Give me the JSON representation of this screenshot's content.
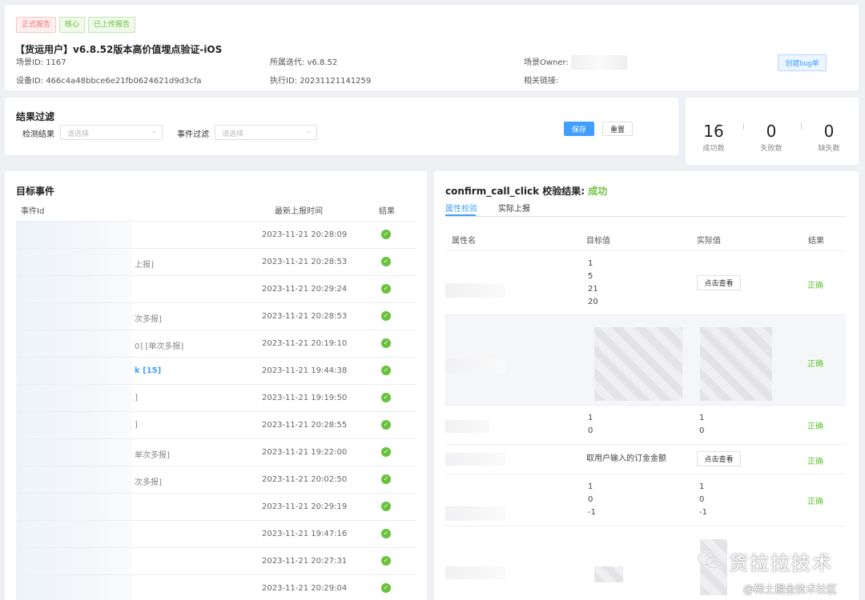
{
  "header": {
    "tags": [
      "正式报告",
      "核心",
      "已上传报告"
    ],
    "title": "【货运用户】v6.8.52版本高价值埋点验证-iOS",
    "scene_id": "场景ID:  1167",
    "iteration": "所属迭代:  v6.8.52",
    "owner_label": "场景Owner:",
    "device_id": "设备ID:  466c4a48bbce6e21fb0624621d9d3cfa",
    "exec_id": "执行ID:  20231121141259",
    "link_label": "相关链接:",
    "bug_button": "创建bug单"
  },
  "filter": {
    "title": "结果过滤",
    "detect_label": "检测结果",
    "event_label": "事件过滤",
    "placeholder": "请选择",
    "save": "保存",
    "reset": "重置"
  },
  "stats": {
    "success": {
      "value": "16",
      "label": "成功数"
    },
    "fail": {
      "value": "0",
      "label": "失败数"
    },
    "missing": {
      "value": "0",
      "label": "缺失数"
    }
  },
  "events": {
    "title": "目标事件",
    "col_id": "事件Id",
    "col_time": "最新上报时间",
    "col_result": "结果",
    "rows": [
      {
        "tail": "",
        "time": "2023-11-21 20:28:09"
      },
      {
        "tail": "上报]",
        "time": "2023-11-21 20:28:53"
      },
      {
        "tail": "",
        "time": "2023-11-21 20:29:24"
      },
      {
        "tail": "次多报]",
        "time": "2023-11-21 20:28:53"
      },
      {
        "tail": "0] [单次多报]",
        "time": "2023-11-21 20:19:10"
      },
      {
        "tail": "k [15]",
        "time": "2023-11-21 19:44:38"
      },
      {
        "tail": "]",
        "time": "2023-11-21 19:19:50"
      },
      {
        "tail": "]",
        "time": "2023-11-21 20:28:55"
      },
      {
        "tail": "单次多报]",
        "time": "2023-11-21 19:22:00"
      },
      {
        "tail": "次多报]",
        "time": "2023-11-21 20:02:50"
      },
      {
        "tail": "",
        "time": "2023-11-21 20:29:19"
      },
      {
        "tail": "",
        "time": "2023-11-21 19:47:16"
      },
      {
        "tail": "",
        "time": "2023-11-21 20:27:31"
      },
      {
        "tail": "",
        "time": "2023-11-21 20:29:04"
      }
    ]
  },
  "verify": {
    "title": "confirm_call_click 校验结果: ",
    "status": "成功",
    "tab_attr": "属性校验",
    "tab_actual": "实际上报",
    "col_name": "属性名",
    "col_target": "目标值",
    "col_actual": "实际值",
    "col_result": "结果",
    "view_button": "点击查看",
    "correct": "正确",
    "row1_target": [
      "1",
      "5",
      "21",
      "20"
    ],
    "row3_target": [
      "1",
      "0"
    ],
    "row3_actual": [
      "1",
      "0"
    ],
    "row4_target": "取用户输入的订金金额",
    "row5_target": [
      "1",
      "0",
      "-1"
    ],
    "row5_actual": [
      "1",
      "0",
      "-1"
    ]
  },
  "watermark": {
    "brand": "货拉拉技术",
    "site": "@稀土掘金技术社区"
  },
  "icons": {
    "check": "check-circle-icon",
    "chevron": "chevron-down-icon",
    "wechat": "wechat-icon"
  },
  "colors": {
    "primary": "#409eff",
    "success": "#67c23a",
    "danger": "#f56c6c"
  }
}
